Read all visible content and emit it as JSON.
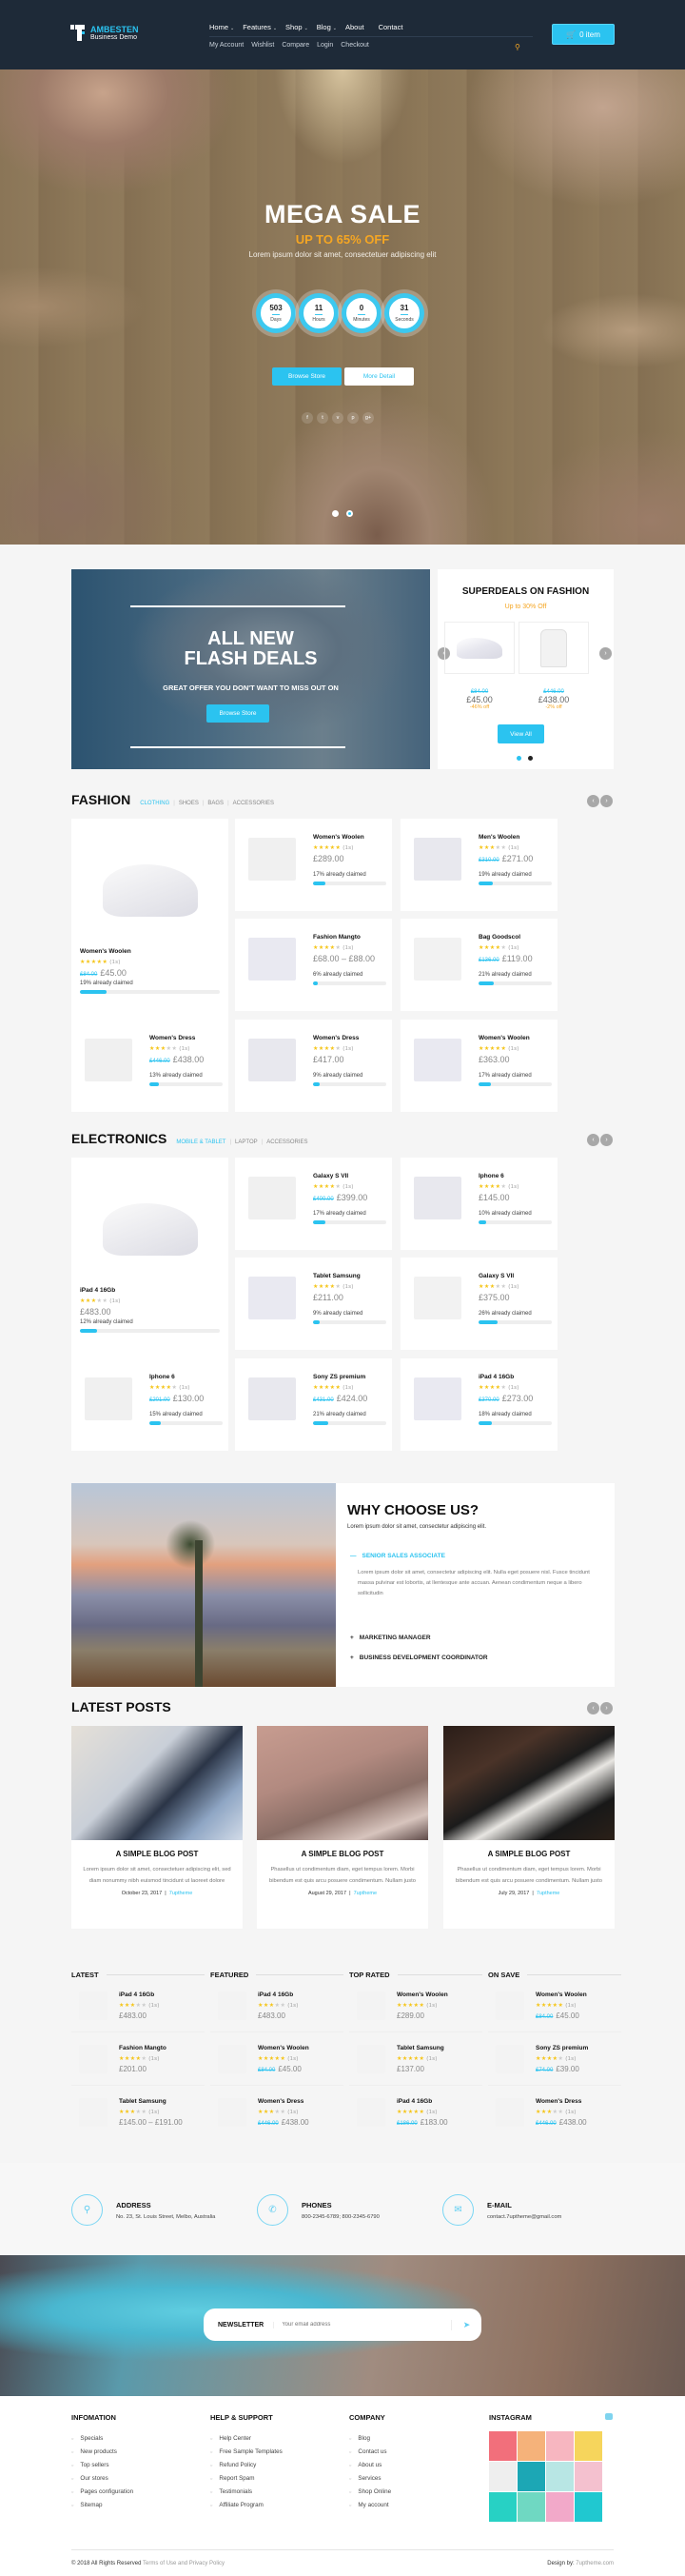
{
  "header": {
    "brand": "AMBESTEN",
    "tagline": "Business Demo",
    "nav_main": [
      {
        "label": "Home",
        "has_dropdown": true
      },
      {
        "label": "Features",
        "has_dropdown": true
      },
      {
        "label": "Shop",
        "has_dropdown": true
      },
      {
        "label": "Blog",
        "has_dropdown": true
      },
      {
        "label": "About",
        "has_dropdown": false
      },
      {
        "label": "Contact",
        "has_dropdown": false
      }
    ],
    "nav_secondary": [
      "My Account",
      "Wishlist",
      "Compare",
      "Login",
      "Checkout"
    ],
    "cart_label": "0 item",
    "icons": {
      "search": "search-icon",
      "cart": "cart-icon"
    }
  },
  "hero": {
    "title": "MEGA SALE",
    "subtitle": "UP TO 65% OFF",
    "description": "Lorem ipsum dolor sit amet, consectetuer adipiscing elit",
    "countdown": [
      {
        "value": "503",
        "unit": "Days"
      },
      {
        "value": "11",
        "unit": "Hours"
      },
      {
        "value": "0",
        "unit": "Minutes"
      },
      {
        "value": "31",
        "unit": "Seconds"
      }
    ],
    "btn_primary": "Browse Store",
    "btn_secondary": "More Detail",
    "socials": [
      "f",
      "t",
      "v",
      "p",
      "g+"
    ],
    "slides": 2,
    "active_slide": 2,
    "accent": "#2bc3f0",
    "highlight": "#f5a623"
  },
  "flash": {
    "title_line1": "ALL NEW",
    "title_line2": "FLASH DEALS",
    "subtitle": "GREAT OFFER YOU DON'T WANT TO MISS OUT ON",
    "button": "Browse Store"
  },
  "superdeals": {
    "title": "SUPERDEALS ON FASHION",
    "subtitle": "Up to 30% Off",
    "items": [
      {
        "old_price": "£84.00",
        "price": "£45.00",
        "discount": "-46% off"
      },
      {
        "old_price": "£446.00",
        "price": "£438.00",
        "discount": "-2% off"
      }
    ],
    "button": "View All",
    "pages": 2,
    "active_page": 1
  },
  "fashion": {
    "title": "FASHION",
    "tabs": [
      "CLOTHING",
      "SHOES",
      "BAGS",
      "ACCESSORIES"
    ],
    "active_tab": 0,
    "featured": {
      "name": "Women's Woolen",
      "rating": 5,
      "count": "(1s)",
      "old_price": "£84.00",
      "price": "£45.00",
      "claimed": "19% already claimed",
      "claimed_pct": 19
    },
    "products": [
      {
        "name": "Women's Woolen",
        "rating": 5,
        "count": "(1s)",
        "old_price": "",
        "price": "£289.00",
        "claimed": "17% already claimed",
        "claimed_pct": 17
      },
      {
        "name": "Men's Woolen",
        "rating": 3,
        "count": "(1s)",
        "old_price": "£310.00",
        "price": "£271.00",
        "claimed": "19% already claimed",
        "claimed_pct": 19
      },
      {
        "name": "Fashion Mangto",
        "rating": 4,
        "count": "(1s)",
        "old_price": "",
        "price": "£68.00 – £88.00",
        "claimed": "6% already claimed",
        "claimed_pct": 6
      },
      {
        "name": "Bag Goodscol",
        "rating": 4,
        "count": "(1s)",
        "old_price": "£136.00",
        "price": "£119.00",
        "claimed": "21% already claimed",
        "claimed_pct": 21
      },
      {
        "name": "Women's Dress",
        "rating": 3,
        "count": "(1s)",
        "old_price": "£446.00",
        "price": "£438.00",
        "claimed": "13% already claimed",
        "claimed_pct": 13
      },
      {
        "name": "Women's Dress",
        "rating": 4,
        "count": "(1s)",
        "old_price": "",
        "price": "£417.00",
        "claimed": "9% already claimed",
        "claimed_pct": 9
      },
      {
        "name": "Women's Woolen",
        "rating": 5,
        "count": "(1s)",
        "old_price": "",
        "price": "£363.00",
        "claimed": "17% already claimed",
        "claimed_pct": 17
      }
    ]
  },
  "electronics": {
    "title": "ELECTRONICS",
    "tabs": [
      "MOBILE & TABLET",
      "LAPTOP",
      "ACCESSORIES"
    ],
    "active_tab": 0,
    "featured": {
      "name": "iPad 4 16Gb",
      "rating": 3,
      "count": "(1s)",
      "old_price": "",
      "price": "£483.00",
      "claimed": "12% already claimed",
      "claimed_pct": 12
    },
    "products": [
      {
        "name": "Galaxy S VII",
        "rating": 4,
        "count": "(1s)",
        "old_price": "£400.00",
        "price": "£399.00",
        "claimed": "17% already claimed",
        "claimed_pct": 17
      },
      {
        "name": "Iphone 6",
        "rating": 4,
        "count": "(1s)",
        "old_price": "",
        "price": "£145.00",
        "claimed": "10% already claimed",
        "claimed_pct": 10
      },
      {
        "name": "Tablet Samsung",
        "rating": 4,
        "count": "(1s)",
        "old_price": "",
        "price": "£211.00",
        "claimed": "9% already claimed",
        "claimed_pct": 9
      },
      {
        "name": "Galaxy S VII",
        "rating": 3,
        "count": "(1s)",
        "old_price": "",
        "price": "£375.00",
        "claimed": "26% already claimed",
        "claimed_pct": 26
      },
      {
        "name": "Iphone 6",
        "rating": 4,
        "count": "(1s)",
        "old_price": "£201.00",
        "price": "£130.00",
        "claimed": "15% already claimed",
        "claimed_pct": 15
      },
      {
        "name": "Sony ZS premium",
        "rating": 5,
        "count": "(1s)",
        "old_price": "£431.00",
        "price": "£424.00",
        "claimed": "21% already claimed",
        "claimed_pct": 21
      },
      {
        "name": "iPad 4 16Gb",
        "rating": 4,
        "count": "(1s)",
        "old_price": "£370.00",
        "price": "£273.00",
        "claimed": "18% already claimed",
        "claimed_pct": 18
      }
    ]
  },
  "why": {
    "title": "WHY CHOOSE US?",
    "description": "Lorem ipsum dolor sit amet, consectetur adipiscing elit.",
    "accordion": [
      {
        "title": "SENIOR SALES ASSOCIATE",
        "open": true,
        "body": "Lorem ipsum dolor sit amet, consectetur adipiscing elit. Nulla eget posuere nisl. Fusce tincidunt massa pulvinar est lobortis, at llentesque ante accuan. Aenean condimentum neque a libero sollicitudin"
      },
      {
        "title": "MARKETING MANAGER",
        "open": false,
        "body": ""
      },
      {
        "title": "BUSINESS DEVELOPMENT COORDINATOR",
        "open": false,
        "body": ""
      }
    ]
  },
  "posts": {
    "title": "LATEST POSTS",
    "items": [
      {
        "title": "A SIMPLE BLOG POST",
        "excerpt": "Lorem ipsum dolor sit amet, consectetuer adipiscing elit, sed diam nonummy nibh euismod tincidunt ut laoreet dolore",
        "date": "October 23, 2017",
        "author": "7uptheme"
      },
      {
        "title": "A SIMPLE BLOG POST",
        "excerpt": "Phasellus ut condimentum diam, eget tempus lorem. Morbi bibendum est quis arcu posuere condimentum. Nullam justo",
        "date": "August 29, 2017",
        "author": "7uptheme"
      },
      {
        "title": "A SIMPLE BLOG POST",
        "excerpt": "Phasellus ut condimentum diam, eget tempus lorem. Morbi bibendum est quis arcu posuere condimentum. Nullam justo",
        "date": "July 29, 2017",
        "author": "7uptheme"
      }
    ]
  },
  "lists": [
    {
      "title": "LATEST",
      "items": [
        {
          "name": "iPad 4 16Gb",
          "rating": 3,
          "count": "(1s)",
          "old_price": "",
          "price": "£483.00"
        },
        {
          "name": "Fashion Mangto",
          "rating": 4,
          "count": "(1s)",
          "old_price": "",
          "price": "£201.00"
        },
        {
          "name": "Tablet Samsung",
          "rating": 3,
          "count": "(1s)",
          "old_price": "",
          "price": "£145.00 – £191.00"
        }
      ]
    },
    {
      "title": "FEATURED",
      "items": [
        {
          "name": "iPad 4 16Gb",
          "rating": 3,
          "count": "(1s)",
          "old_price": "",
          "price": "£483.00"
        },
        {
          "name": "Women's Woolen",
          "rating": 5,
          "count": "(1s)",
          "old_price": "£84.00",
          "price": "£45.00"
        },
        {
          "name": "Women's Dress",
          "rating": 3,
          "count": "(1s)",
          "old_price": "£446.00",
          "price": "£438.00"
        }
      ]
    },
    {
      "title": "TOP RATED",
      "items": [
        {
          "name": "Women's Woolen",
          "rating": 5,
          "count": "(1s)",
          "old_price": "",
          "price": "£289.00"
        },
        {
          "name": "Tablet Samsung",
          "rating": 5,
          "count": "(1s)",
          "old_price": "",
          "price": "£137.00"
        },
        {
          "name": "iPad 4 16Gb",
          "rating": 5,
          "count": "(1s)",
          "old_price": "£186.00",
          "price": "£183.00"
        }
      ]
    },
    {
      "title": "ON SAVE",
      "items": [
        {
          "name": "Women's Woolen",
          "rating": 5,
          "count": "(1s)",
          "old_price": "£84.00",
          "price": "£45.00"
        },
        {
          "name": "Sony ZS premium",
          "rating": 4,
          "count": "(1s)",
          "old_price": "£74.00",
          "price": "£39.00"
        },
        {
          "name": "Women's Dress",
          "rating": 3,
          "count": "(1s)",
          "old_price": "£446.00",
          "price": "£438.00"
        }
      ]
    }
  ],
  "contact": {
    "address_label": "ADDRESS",
    "address": "No. 23, St. Louis Street, Melbo, Australia",
    "phones_label": "PHONES",
    "phones": "800-2345-6789; 800-2345-6790",
    "email_label": "E-MAIL",
    "email": "contact.7uptheme@gmail.com"
  },
  "newsletter": {
    "label": "NEWSLETTER",
    "placeholder": "Your email address"
  },
  "footer": {
    "columns": [
      {
        "title": "INFOMATION",
        "links": [
          "Specials",
          "New products",
          "Top sellers",
          "Our stores",
          "Pages configuration",
          "Sitemap"
        ]
      },
      {
        "title": "HELP & SUPPORT",
        "links": [
          "Help Center",
          "Free Sample Templates",
          "Refund Policy",
          "Report Spam",
          "Testimonials",
          "Affiliate Program"
        ]
      },
      {
        "title": "COMPANY",
        "links": [
          "Blog",
          "Contact us",
          "About us",
          "Services",
          "Shop Online",
          "My account"
        ]
      }
    ],
    "instagram_title": "INSTAGRAM",
    "instagram_colors": [
      "#f26f7b",
      "#f5b27a",
      "#f7b6c0",
      "#f6d55c",
      "#eeeeee",
      "#1ca7b5",
      "#b8e6e4",
      "#f4c1cf",
      "#27d1c4",
      "#6fd8c2",
      "#f2a9c9",
      "#20c8d0"
    ],
    "copyright": "© 2018 All Rights Reserved",
    "terms": "Terms of Use and Privacy Policy",
    "design_label": "Design by:",
    "design_site": "7uptheme.com"
  }
}
